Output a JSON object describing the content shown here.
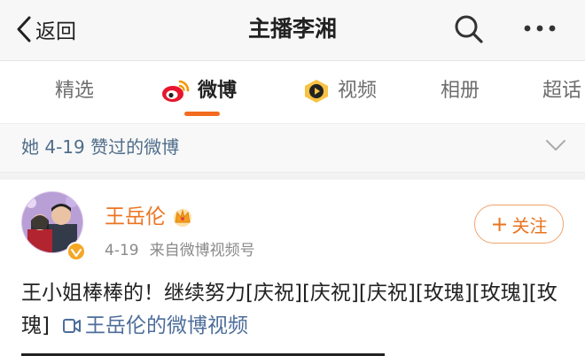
{
  "nav": {
    "back_label": "返回",
    "title": "主播李湘"
  },
  "tabs": [
    {
      "label": "精选",
      "active": false
    },
    {
      "label": "微博",
      "active": true,
      "icon": "weibo-icon"
    },
    {
      "label": "视频",
      "active": false,
      "icon": "video-channel-icon"
    },
    {
      "label": "相册",
      "active": false
    },
    {
      "label": "超话",
      "active": false
    }
  ],
  "liked_header": "她 4-19 赞过的微博",
  "post": {
    "author": "王岳伦",
    "date": "4-19",
    "source": "来自微博视频号",
    "follow_label": "关注",
    "text": "王小姐棒棒的！继续努力[庆祝][庆祝][庆祝][玫瑰][玫瑰][玫瑰]",
    "video_link": "王岳伦的微博视频"
  },
  "colors": {
    "accent": "#f26b1f",
    "author": "#ec7422",
    "link": "#4d6e9b",
    "liked_text": "#4f6d8a",
    "verified_badge": "#f5a623"
  }
}
